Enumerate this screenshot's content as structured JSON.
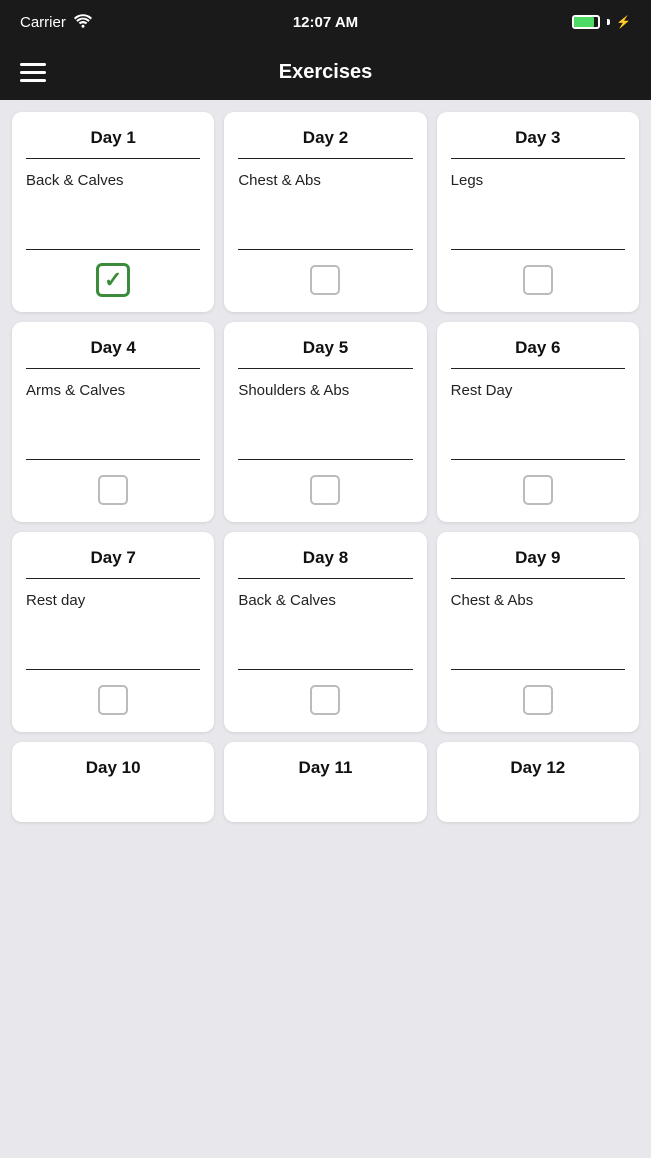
{
  "statusBar": {
    "carrier": "Carrier",
    "time": "12:07 AM",
    "wifi": true,
    "battery": 85
  },
  "nav": {
    "title": "Exercises"
  },
  "cards": [
    {
      "id": 1,
      "day": "Day 1",
      "exercise": "Back & Calves",
      "checked": true
    },
    {
      "id": 2,
      "day": "Day 2",
      "exercise": "Chest & Abs",
      "checked": false
    },
    {
      "id": 3,
      "day": "Day 3",
      "exercise": "Legs",
      "checked": false
    },
    {
      "id": 4,
      "day": "Day 4",
      "exercise": "Arms & Calves",
      "checked": false
    },
    {
      "id": 5,
      "day": "Day 5",
      "exercise": "Shoulders & Abs",
      "checked": false
    },
    {
      "id": 6,
      "day": "Day 6",
      "exercise": "Rest Day",
      "checked": false
    },
    {
      "id": 7,
      "day": "Day 7",
      "exercise": "Rest day",
      "checked": false
    },
    {
      "id": 8,
      "day": "Day 8",
      "exercise": "Back & Calves",
      "checked": false
    },
    {
      "id": 9,
      "day": "Day 9",
      "exercise": "Chest & Abs",
      "checked": false
    }
  ],
  "partialCards": [
    {
      "id": 10,
      "day": "Day 10"
    },
    {
      "id": 11,
      "day": "Day 11"
    },
    {
      "id": 12,
      "day": "Day 12"
    }
  ],
  "colors": {
    "checked": "#3a8c3a",
    "unchecked": "#bbb"
  }
}
